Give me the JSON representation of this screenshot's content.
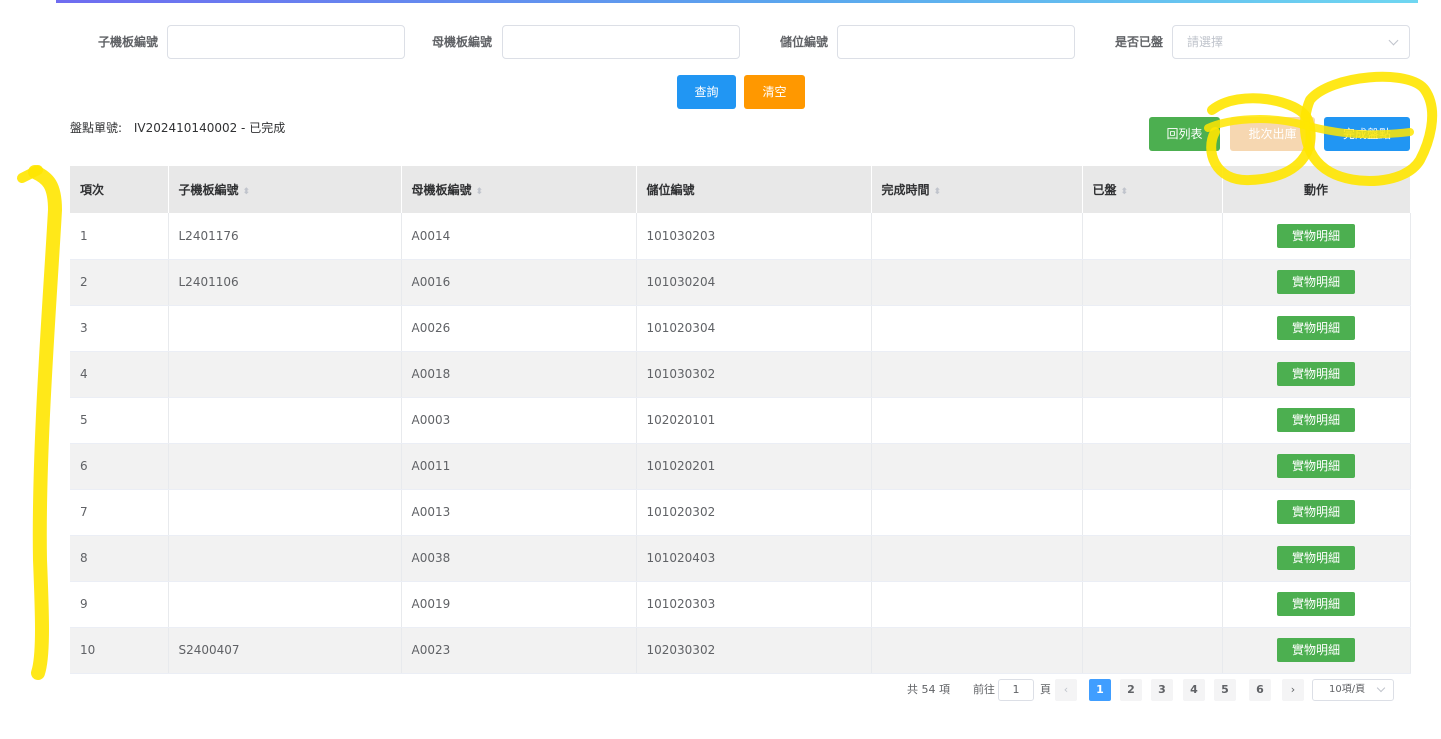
{
  "filters": {
    "child_board_label": "子機板編號",
    "mother_board_label": "母機板編號",
    "location_label": "儲位編號",
    "counted_label": "是否已盤",
    "counted_placeholder": "請選擇"
  },
  "actions": {
    "query": "查詢",
    "clear": "清空",
    "back_to_list": "回列表",
    "batch_outbound": "批次出庫",
    "complete_count": "完成盤點"
  },
  "doc": {
    "label": "盤點單號:",
    "value": "IV202410140002 - 已完成"
  },
  "table": {
    "headers": [
      "項次",
      "子機板編號",
      "母機板編號",
      "儲位編號",
      "完成時間",
      "已盤",
      "動作"
    ],
    "detail_label": "實物明細",
    "rows": [
      [
        "1",
        "L2401176",
        "A0014",
        "101030203",
        "",
        ""
      ],
      [
        "2",
        "L2401106",
        "A0016",
        "101030204",
        "",
        ""
      ],
      [
        "3",
        "",
        "A0026",
        "101020304",
        "",
        ""
      ],
      [
        "4",
        "",
        "A0018",
        "101030302",
        "",
        ""
      ],
      [
        "5",
        "",
        "A0003",
        "102020101",
        "",
        ""
      ],
      [
        "6",
        "",
        "A0011",
        "101020201",
        "",
        ""
      ],
      [
        "7",
        "",
        "A0013",
        "101020302",
        "",
        ""
      ],
      [
        "8",
        "",
        "A0038",
        "101020403",
        "",
        ""
      ],
      [
        "9",
        "",
        "A0019",
        "101020303",
        "",
        ""
      ],
      [
        "10",
        "S2400407",
        "A0023",
        "102030302",
        "",
        ""
      ]
    ]
  },
  "pagination": {
    "total": "共 54 項",
    "goto_label": "前往",
    "goto_value": "1",
    "page_label": "頁",
    "pages": [
      "1",
      "2",
      "3",
      "4",
      "5",
      "6"
    ],
    "current_page": "1",
    "page_size": "10項/頁"
  },
  "colors": {
    "primary_blue": "#2196f3",
    "orange": "#ff9800",
    "green": "#4caf50",
    "highlight_yellow": "#ffe600"
  },
  "annotations": {
    "marker_color": "#ffe600"
  }
}
